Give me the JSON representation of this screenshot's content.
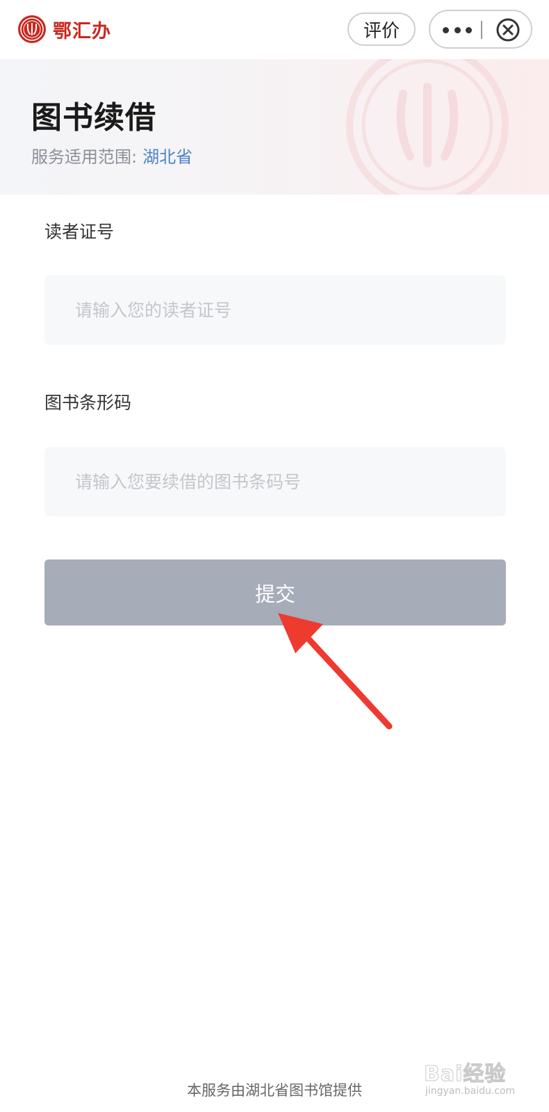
{
  "topbar": {
    "brand_name": "鄂汇办",
    "rate_label": "评价",
    "more_icon": "more-dots-icon",
    "close_icon": "close-circle-icon"
  },
  "header": {
    "title": "图书续借",
    "scope_label": "服务适用范围:",
    "scope_value": "湖北省"
  },
  "form": {
    "reader_id": {
      "label": "读者证号",
      "value": "",
      "placeholder": "请输入您的读者证号"
    },
    "barcode": {
      "label": "图书条形码",
      "value": "",
      "placeholder": "请输入您要续借的图书条码号"
    },
    "submit_label": "提交"
  },
  "footer": {
    "note": "本服务由湖北省图书馆提供"
  },
  "watermark": {
    "main": "Bai经验",
    "sub": "jingyan.baidu.com"
  },
  "colors": {
    "brand": "#c8281e",
    "scope_link": "#4a84c9",
    "submit_bg": "#a6acb8",
    "annotation_arrow": "#ee3a2f"
  }
}
